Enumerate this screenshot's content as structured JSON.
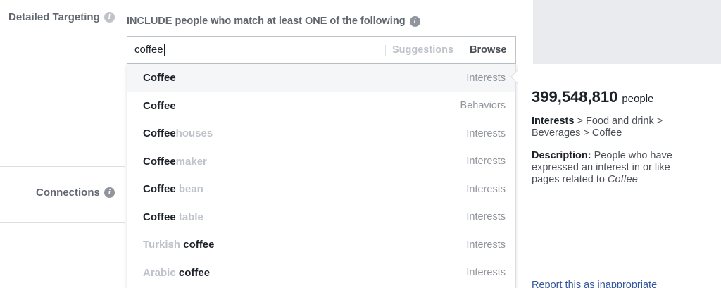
{
  "detailed_targeting": {
    "label": "Detailed Targeting"
  },
  "include_header": "INCLUDE people who match at least ONE of the following",
  "search": {
    "value": "coffee",
    "suggestions_label": "Suggestions",
    "browse_label": "Browse"
  },
  "connections": {
    "label": "Connections"
  },
  "results": [
    {
      "match": "Coffee",
      "rest": "",
      "prefix": "",
      "type": "Interests"
    },
    {
      "match": "Coffee",
      "rest": "",
      "prefix": "",
      "type": "Behaviors"
    },
    {
      "match": "Coffee",
      "rest": "houses",
      "prefix": "",
      "type": "Interests"
    },
    {
      "match": "Coffee",
      "rest": "maker",
      "prefix": "",
      "type": "Interests"
    },
    {
      "match": "Coffee",
      "rest": " bean",
      "prefix": "",
      "type": "Interests"
    },
    {
      "match": "Coffee",
      "rest": " table",
      "prefix": "",
      "type": "Interests"
    },
    {
      "match": "coffee",
      "rest": "",
      "prefix": "Turkish ",
      "type": "Interests"
    },
    {
      "match": "coffee",
      "rest": "",
      "prefix": "Arabic ",
      "type": "Interests"
    }
  ],
  "detail": {
    "audience_size": "399,548,810",
    "audience_unit": "people",
    "path_head": "Interests",
    "path_tail": " > Food and drink > Beverages > Coffee",
    "description_label": "Description:",
    "description_text": " People who have expressed an interest in or like pages related to ",
    "description_topic": "Coffee",
    "report_link": "Report this as inappropriate"
  },
  "colors": {
    "link": "#365899",
    "muted": "#90949c",
    "text": "#1d2129",
    "background_right": "#e9ebee"
  }
}
